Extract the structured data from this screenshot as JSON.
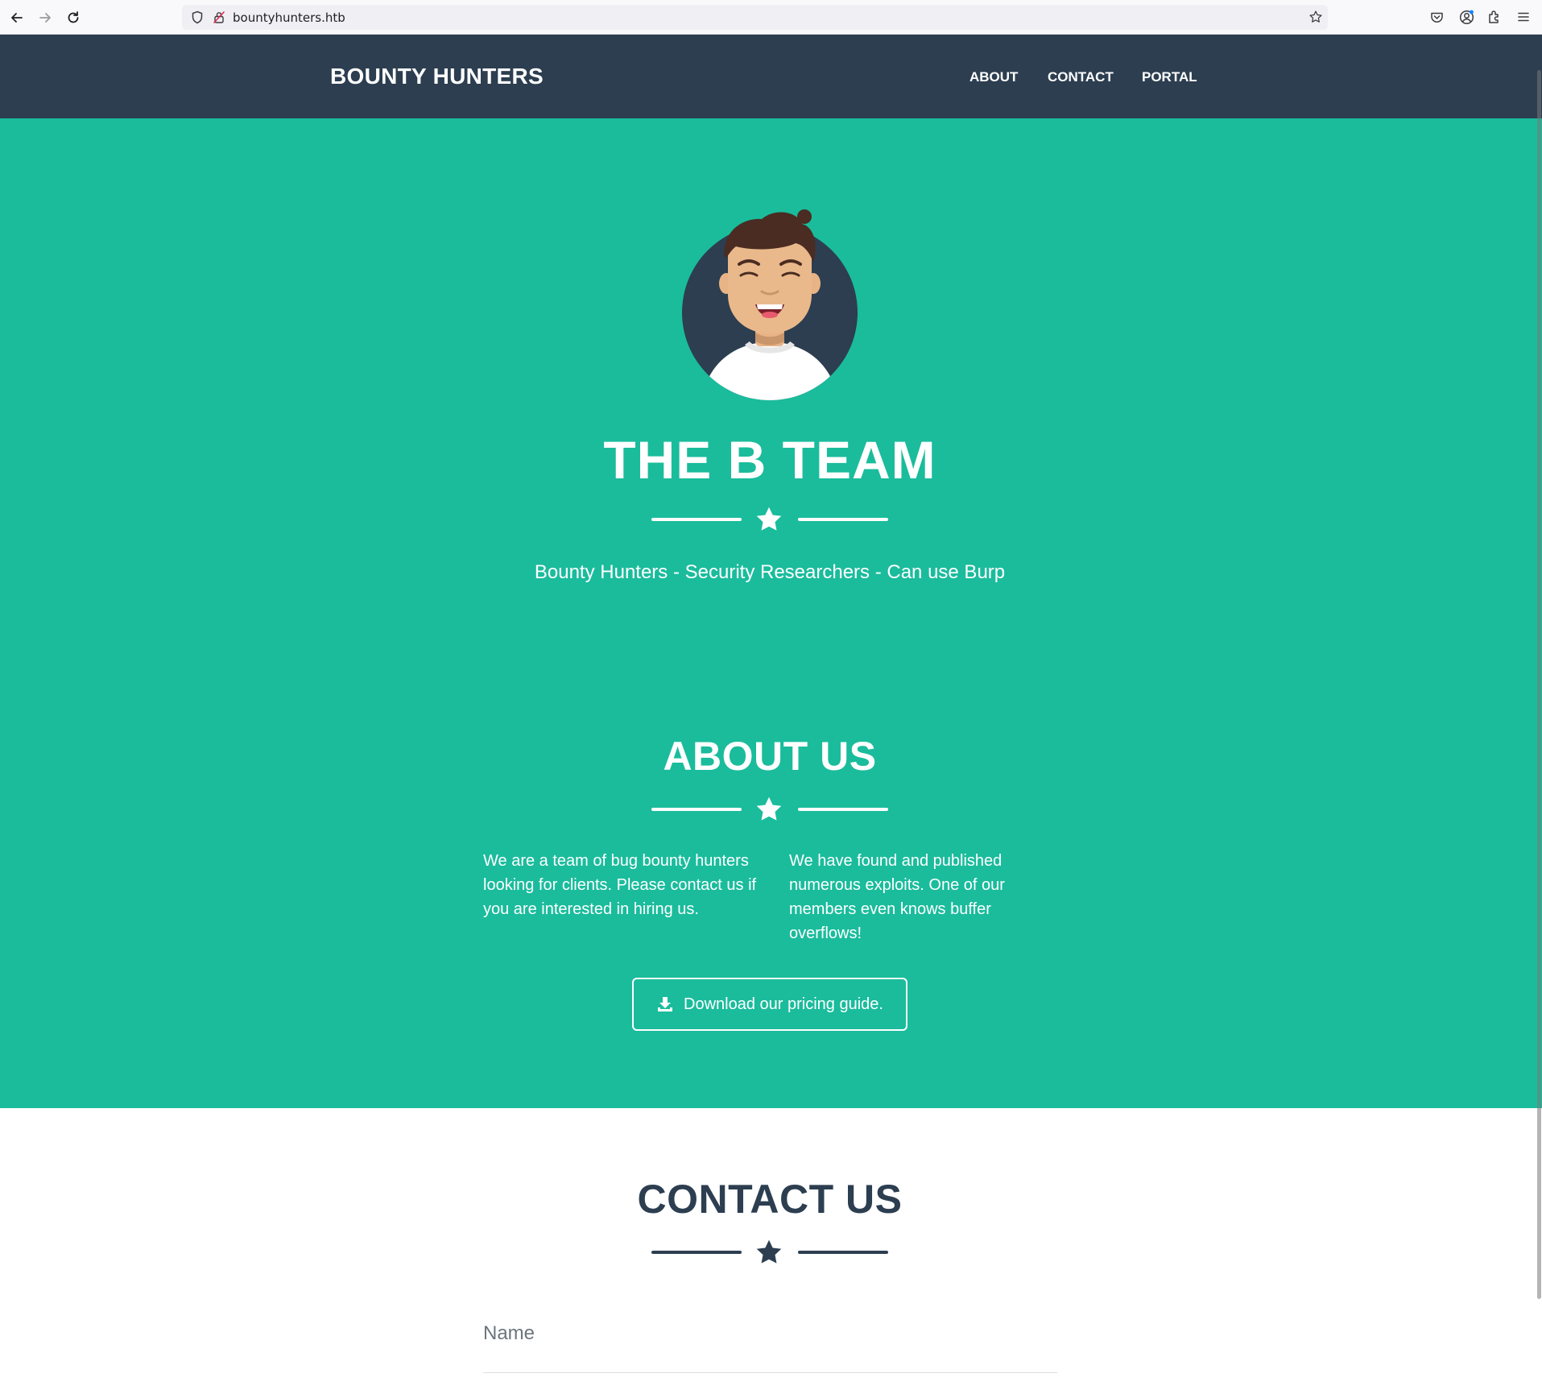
{
  "browser": {
    "url": "bountyhunters.htb",
    "icons": [
      "back-arrow-icon",
      "forward-arrow-icon",
      "reload-icon",
      "shield-icon",
      "insecure-lock-icon",
      "bookmark-star-icon",
      "pocket-icon",
      "account-icon",
      "extensions-icon",
      "menu-icon"
    ]
  },
  "navbar": {
    "brand": "BOUNTY HUNTERS",
    "links": [
      {
        "label": "ABOUT"
      },
      {
        "label": "CONTACT"
      },
      {
        "label": "PORTAL"
      }
    ]
  },
  "hero": {
    "title": "THE B TEAM",
    "subtitle": "Bounty Hunters - Security Researchers - Can use Burp"
  },
  "about": {
    "title": "ABOUT US",
    "paragraphs": [
      "We are a team of bug bounty hunters looking for clients. Please contact us if you are interested in hiring us.",
      "We have found and published numerous exploits. One of our members even knows buffer overflows!"
    ],
    "button_label": "Download our pricing guide."
  },
  "contact": {
    "title": "CONTACT US",
    "fields": [
      {
        "label": "Name"
      }
    ]
  },
  "colors": {
    "navbar": "#2c3e50",
    "accent": "#1abc9c",
    "white": "#ffffff",
    "dark_text": "#2c3e50"
  }
}
